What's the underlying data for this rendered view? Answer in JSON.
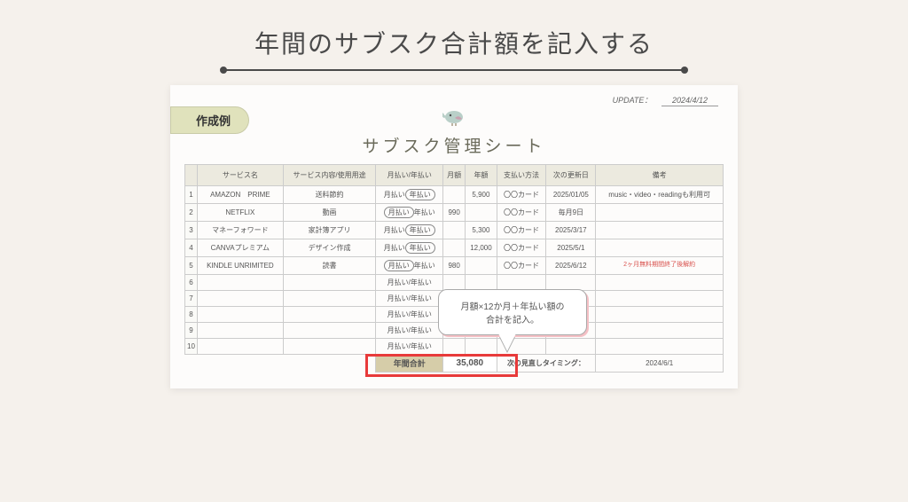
{
  "mainTitle": "年間のサブスク合計額を記入する",
  "updateLabel": "UPDATE：",
  "updateDate": "2024/4/12",
  "badge": "作成例",
  "sheetTitle": "サブスク管理シート",
  "headers": {
    "num": "",
    "service": "サービス名",
    "content": "サービス内容/使用用途",
    "cycle": "月払い/年払い",
    "monthly": "月額",
    "yearly": "年額",
    "payment": "支払い方法",
    "renew": "次の更新日",
    "remarks": "備考"
  },
  "rows": [
    {
      "n": "1",
      "service": "AMAZON　PRIME",
      "content": "送料節約",
      "cyclePre": "月払い",
      "cycleCircled": "年払い",
      "monthly": "",
      "yearly": "5,900",
      "payment": "〇〇カード",
      "renew": "2025/01/05",
      "remarks": "music・video・readingも利用可"
    },
    {
      "n": "2",
      "service": "NETFLIX",
      "content": "動画",
      "cyclePre": "",
      "cycleCircled": "月払い",
      "cyclePost": "年払い",
      "monthly": "990",
      "yearly": "",
      "payment": "〇〇カード",
      "renew": "毎月9日",
      "remarks": ""
    },
    {
      "n": "3",
      "service": "マネーフォワード",
      "content": "家計簿アプリ",
      "cyclePre": "月払い",
      "cycleCircled": "年払い",
      "monthly": "",
      "yearly": "5,300",
      "payment": "〇〇カード",
      "renew": "2025/3/17",
      "remarks": ""
    },
    {
      "n": "4",
      "service": "CANVAプレミアム",
      "content": "デザイン作成",
      "cyclePre": "月払い",
      "cycleCircled": "年払い",
      "monthly": "",
      "yearly": "12,000",
      "payment": "〇〇カード",
      "renew": "2025/5/1",
      "remarks": ""
    },
    {
      "n": "5",
      "service": "KINDLE UNRIMITED",
      "content": "読書",
      "cyclePre": "",
      "cycleCircled": "月払い",
      "cyclePost": "年払い",
      "monthly": "980",
      "yearly": "",
      "payment": "〇〇カード",
      "renew": "2025/6/12",
      "remarks": "2ヶ月無料期間終了後解約",
      "remarkRed": true
    },
    {
      "n": "6",
      "cycle": "月払い/年払い"
    },
    {
      "n": "7",
      "cycle": "月払い/年払い"
    },
    {
      "n": "8",
      "cycle": "月払い/年払い"
    },
    {
      "n": "9",
      "cycle": "月払い/年払い"
    },
    {
      "n": "10",
      "cycle": "月払い/年払い"
    }
  ],
  "totalLabel": "年間合計",
  "totalValue": "35,080",
  "timingLabel": "次の見直しタイミング：",
  "timingValue": "2024/6/1",
  "speech": {
    "line1": "月額×12か月＋年払い額の",
    "line2": "合計を記入。"
  }
}
